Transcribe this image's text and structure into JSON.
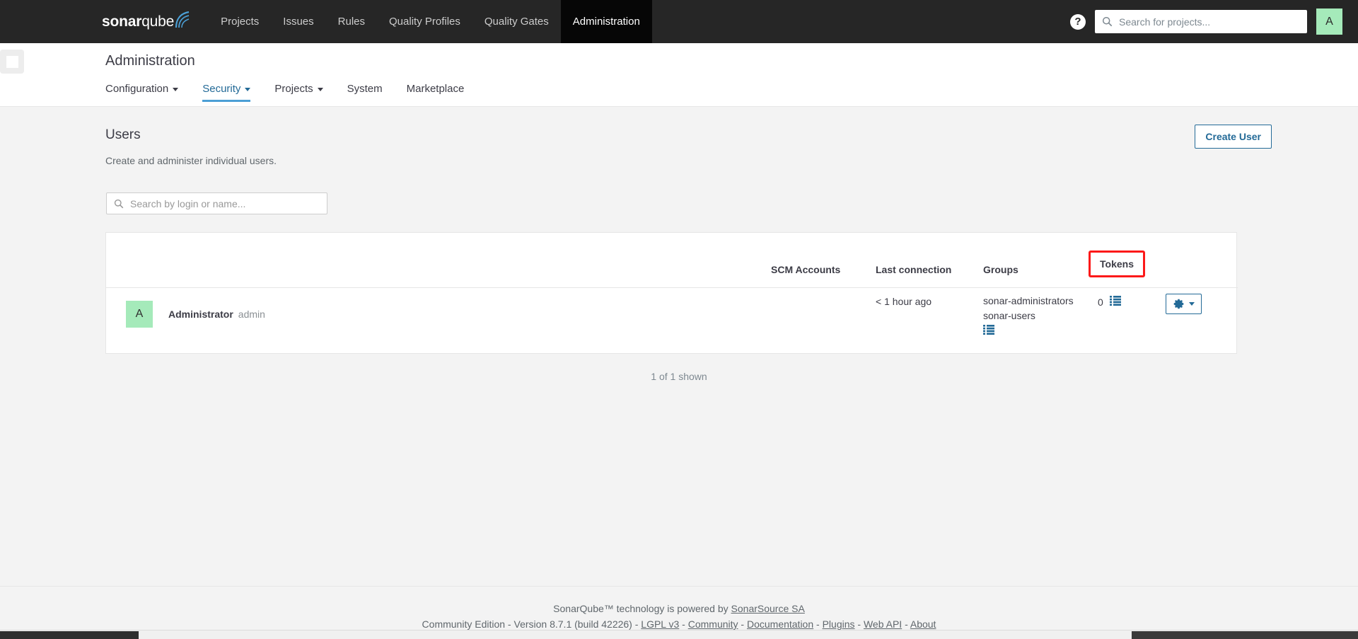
{
  "topnav": {
    "logo": {
      "bold": "sonar",
      "light": "qube",
      "icon": "sonarqube-logo"
    },
    "items": [
      {
        "label": "Projects",
        "active": false
      },
      {
        "label": "Issues",
        "active": false
      },
      {
        "label": "Rules",
        "active": false
      },
      {
        "label": "Quality Profiles",
        "active": false
      },
      {
        "label": "Quality Gates",
        "active": false
      },
      {
        "label": "Administration",
        "active": true
      }
    ],
    "help_icon": "help-circle-icon",
    "search": {
      "placeholder": "Search for projects...",
      "value": "",
      "icon": "search-icon"
    },
    "avatar": {
      "initial": "A",
      "color": "#a5eaba"
    }
  },
  "subheader": {
    "title": "Administration",
    "tabs": [
      {
        "label": "Configuration",
        "has_caret": true,
        "active": false
      },
      {
        "label": "Security",
        "has_caret": true,
        "active": true
      },
      {
        "label": "Projects",
        "has_caret": true,
        "active": false
      },
      {
        "label": "System",
        "has_caret": false,
        "active": false
      },
      {
        "label": "Marketplace",
        "has_caret": false,
        "active": false
      }
    ]
  },
  "main": {
    "heading": "Users",
    "description": "Create and administer individual users.",
    "create_button": "Create User",
    "search": {
      "placeholder": "Search by login or name...",
      "value": "",
      "icon": "search-icon"
    },
    "table": {
      "columns": [
        "",
        "SCM Accounts",
        "Last connection",
        "Groups",
        "Tokens",
        ""
      ],
      "highlighted_column": "Tokens",
      "highlight_color": "#fc1919",
      "rows": [
        {
          "avatar_initial": "A",
          "avatar_color": "#a5eaba",
          "name": "Administrator",
          "login": "admin",
          "scm_accounts": "",
          "last_connection": "< 1 hour ago",
          "groups": [
            "sonar-administrators",
            "sonar-users"
          ],
          "groups_icon": "list-icon",
          "tokens_count": "0",
          "tokens_icon": "list-icon",
          "actions_icon": "gear-icon"
        }
      ]
    },
    "shown_count": "1 of 1 shown"
  },
  "footer": {
    "line1_prefix": "SonarQube™ technology is powered by ",
    "line1_link": "SonarSource SA",
    "edition": "Community Edition",
    "version": "Version 8.7.1 (build 42226)",
    "links": [
      "LGPL v3",
      "Community",
      "Documentation",
      "Plugins",
      "Web API",
      "About"
    ],
    "separator": " - "
  }
}
